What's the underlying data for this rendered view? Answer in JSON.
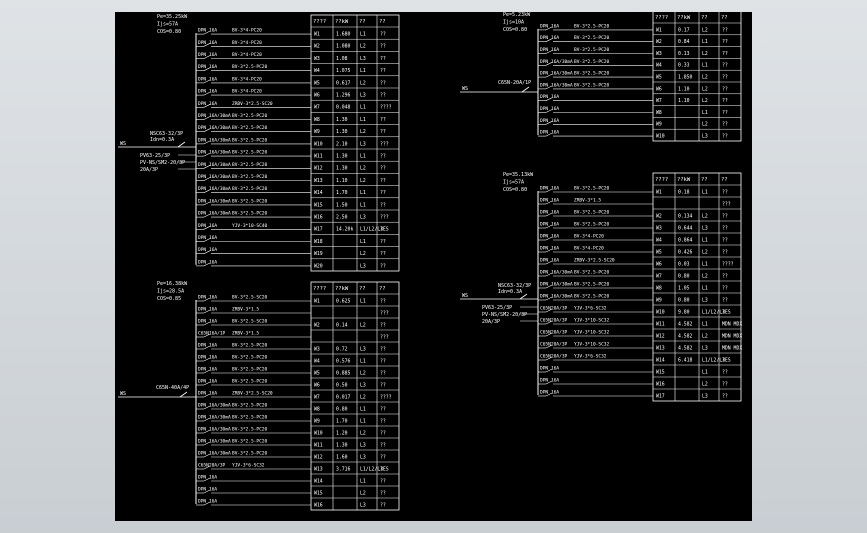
{
  "diagram": {
    "panels": [
      {
        "id": "p1",
        "header": [
          "Pe=35.25kW",
          "Ijs=57A",
          "COS=0.80"
        ],
        "incoming": {
          "label": "WS",
          "breaker": [
            "NSC63-32/3P",
            "Idn=0.3A"
          ],
          "extra": [
            "PV63-25/3P",
            "PV-NS/SM2-20/3P",
            "20A/3P"
          ]
        },
        "header_row": [
          "????",
          "??kW",
          "??",
          "??"
        ],
        "rows": [
          {
            "pre": "DPN",
            "brk": "16A",
            "cable": "BV-3*4-PC20",
            "circ": "W1",
            "kw": "1.680",
            "ph": "L1",
            "use": "??"
          },
          {
            "pre": "DPN",
            "brk": "16A",
            "cable": "BV-3*4-PC20",
            "circ": "W2",
            "kw": "1.080",
            "ph": "L2",
            "use": "??"
          },
          {
            "pre": "DPN",
            "brk": "16A",
            "cable": "BV-3*4-PC20",
            "circ": "W3",
            "kw": "1.08",
            "ph": "L3",
            "use": "??"
          },
          {
            "pre": "DPN",
            "brk": "16A",
            "cable": "BV-3*2.5-PC20",
            "circ": "W4",
            "kw": "1.075",
            "ph": "L1",
            "use": "??"
          },
          {
            "pre": "DPN",
            "brk": "16A",
            "cable": "BV-3*4-PC20",
            "circ": "W5",
            "kw": "0.617",
            "ph": "L2",
            "use": "??"
          },
          {
            "pre": "DPN",
            "brk": "16A",
            "cable": "BV-3*4-PC20",
            "circ": "W6",
            "kw": "1.296",
            "ph": "L3",
            "use": "??"
          },
          {
            "pre": "DPN",
            "brk": "16A",
            "cable": "ZRBV-3*2.5-SC20",
            "circ": "W7",
            "kw": "0.048",
            "ph": "L1",
            "use": "????"
          },
          {
            "pre": "DPN",
            "brk": "16A/30mA",
            "cable": "BV-3*2.5-PC20",
            "circ": "W8",
            "kw": "1.30",
            "ph": "L1",
            "use": "??"
          },
          {
            "pre": "DPN",
            "brk": "16A/30mA",
            "cable": "BV-3*2.5-PC20",
            "circ": "W9",
            "kw": "1.30",
            "ph": "L2",
            "use": "??"
          },
          {
            "pre": "DPN",
            "brk": "16A/30mA",
            "cable": "BV-3*2.5-PC20",
            "circ": "W10",
            "kw": "2.10",
            "ph": "L3",
            "use": "???"
          },
          {
            "pre": "DPN",
            "brk": "16A/30mA",
            "cable": "BV-3*2.5-PC20",
            "circ": "W11",
            "kw": "1.30",
            "ph": "L1",
            "use": "??"
          },
          {
            "pre": "DPN",
            "brk": "16A/30mA",
            "cable": "BV-3*2.5-PC20",
            "circ": "W12",
            "kw": "1.30",
            "ph": "L2",
            "use": "??"
          },
          {
            "pre": "DPN",
            "brk": "16A/30mA",
            "cable": "BV-3*2.5-PC20",
            "circ": "W13",
            "kw": "1.10",
            "ph": "L2",
            "use": "??"
          },
          {
            "pre": "DPN",
            "brk": "16A/30mA",
            "cable": "BV-3*2.5-PC20",
            "circ": "W14",
            "kw": "1.70",
            "ph": "L1",
            "use": "??"
          },
          {
            "pre": "DPN",
            "brk": "16A/30mA",
            "cable": "BV-3*2.5-PC20",
            "circ": "W15",
            "kw": "1.50",
            "ph": "L1",
            "use": "??"
          },
          {
            "pre": "DPN",
            "brk": "16A/30mA",
            "cable": "BV-3*2.5-PC20",
            "circ": "W16",
            "kw": "2.50",
            "ph": "L3",
            "use": "???"
          },
          {
            "pre": "DPN",
            "brk": "16A",
            "cable": "YJV-3*10-SC40",
            "circ": "W17",
            "kw": "14.20k",
            "ph": "L1/L2/L3",
            "use": "IES"
          },
          {
            "pre": "DPN",
            "brk": "16A",
            "cable": "",
            "circ": "W18",
            "kw": "",
            "ph": "L1",
            "use": "??"
          },
          {
            "pre": "DPN",
            "brk": "16A",
            "cable": "",
            "circ": "W19",
            "kw": "",
            "ph": "L2",
            "use": "??"
          },
          {
            "pre": "DPN",
            "brk": "16A",
            "cable": "",
            "circ": "W20",
            "kw": "",
            "ph": "L3",
            "use": "??"
          }
        ]
      },
      {
        "id": "p2",
        "header": [
          "Pe=16.38kW",
          "Ijs=28.5A",
          "COS=0.85"
        ],
        "incoming": {
          "label": "WS",
          "breaker": [
            "C65N-40A/4P"
          ],
          "extra": []
        },
        "header_row": [
          "????",
          "??kW",
          "??",
          "??"
        ],
        "rows": [
          {
            "pre": "DPN",
            "brk": "16A",
            "cable": "BV-3*2.5-SC20",
            "circ": "W1",
            "kw": "0.625",
            "ph": "L1",
            "use": "??"
          },
          {
            "pre": "DPN",
            "brk": "16A",
            "cable": "ZRBV-3*1.5",
            "circ": "",
            "kw": "",
            "ph": "",
            "use": "???"
          },
          {
            "pre": "DPN",
            "brk": "16A",
            "cable": "BV-3*2.5-SC20",
            "circ": "W2",
            "kw": "0.14",
            "ph": "L2",
            "use": "??"
          },
          {
            "pre": "C65N",
            "brk": "16A/1P",
            "cable": "ZRBV-3*1.5",
            "circ": "",
            "kw": "",
            "ph": "",
            "use": "???"
          },
          {
            "pre": "DPN",
            "brk": "16A",
            "cable": "BV-3*2.5-PC20",
            "circ": "W3",
            "kw": "0.72",
            "ph": "L3",
            "use": "??"
          },
          {
            "pre": "DPN",
            "brk": "16A",
            "cable": "BV-3*2.5-PC20",
            "circ": "W4",
            "kw": "0.576",
            "ph": "L1",
            "use": "??"
          },
          {
            "pre": "DPN",
            "brk": "16A",
            "cable": "BV-3*2.5-PC20",
            "circ": "W5",
            "kw": "0.885",
            "ph": "L2",
            "use": "??"
          },
          {
            "pre": "DPN",
            "brk": "16A",
            "cable": "BV-3*2.5-PC20",
            "circ": "W6",
            "kw": "0.50",
            "ph": "L3",
            "use": "??"
          },
          {
            "pre": "DPN",
            "brk": "16A",
            "cable": "ZRBV-3*2.5-SC20",
            "circ": "W7",
            "kw": "0.017",
            "ph": "L2",
            "use": "????"
          },
          {
            "pre": "DPN",
            "brk": "16A/30mA",
            "cable": "BV-3*2.5-PC20",
            "circ": "W8",
            "kw": "0.80",
            "ph": "L1",
            "use": "??"
          },
          {
            "pre": "DPN",
            "brk": "16A/30mA",
            "cable": "BV-3*2.5-PC20",
            "circ": "W9",
            "kw": "1.70",
            "ph": "L1",
            "use": "??"
          },
          {
            "pre": "DPN",
            "brk": "16A/30mA",
            "cable": "BV-3*2.5-PC20",
            "circ": "W10",
            "kw": "1.20",
            "ph": "L2",
            "use": "??"
          },
          {
            "pre": "DPN",
            "brk": "16A/30mA",
            "cable": "BV-3*2.5-PC20",
            "circ": "W11",
            "kw": "1.30",
            "ph": "L3",
            "use": "??"
          },
          {
            "pre": "DPN",
            "brk": "16A/30mA",
            "cable": "BV-3*2.5-PC20",
            "circ": "W12",
            "kw": "1.60",
            "ph": "L3",
            "use": "??"
          },
          {
            "pre": "C65N",
            "brk": "20A/3P",
            "cable": "YJV-3*6-SC32",
            "circ": "W13",
            "kw": "3.716",
            "ph": "L1/L2/L3",
            "use": "IES"
          },
          {
            "pre": "DPN",
            "brk": "16A",
            "cable": "",
            "circ": "W14",
            "kw": "",
            "ph": "L1",
            "use": "??"
          },
          {
            "pre": "DPN",
            "brk": "16A",
            "cable": "",
            "circ": "W15",
            "kw": "",
            "ph": "L2",
            "use": "??"
          },
          {
            "pre": "DPN",
            "brk": "16A",
            "cable": "",
            "circ": "W16",
            "kw": "",
            "ph": "L3",
            "use": "??"
          }
        ]
      },
      {
        "id": "p3",
        "header": [
          "Pe=5.23kW",
          "Ijs=10A",
          "COS=0.80"
        ],
        "incoming": {
          "label": "WS",
          "breaker": [
            "C65N-20A/1P"
          ],
          "extra": []
        },
        "header_row": [
          "????",
          "??kW",
          "??",
          "??"
        ],
        "rows": [
          {
            "pre": "DPN",
            "brk": "16A",
            "cable": "BV-3*2.5-PC20",
            "circ": "W1",
            "kw": "0.17",
            "ph": "L2",
            "use": "??"
          },
          {
            "pre": "DPN",
            "brk": "16A",
            "cable": "BV-3*2.5-PC20",
            "circ": "W2",
            "kw": "0.84",
            "ph": "L1",
            "use": "??"
          },
          {
            "pre": "DPN",
            "brk": "16A",
            "cable": "BV-3*2.5-PC20",
            "circ": "W3",
            "kw": "0.13",
            "ph": "L2",
            "use": "??"
          },
          {
            "pre": "DPN",
            "brk": "16A/30mA",
            "cable": "BV-3*2.5-PC20",
            "circ": "W4",
            "kw": "0.33",
            "ph": "L1",
            "use": "??"
          },
          {
            "pre": "DPN",
            "brk": "16A/30mA",
            "cable": "BV-3*2.5-PC20",
            "circ": "W5",
            "kw": "1.850",
            "ph": "L2",
            "use": "??"
          },
          {
            "pre": "DPN",
            "brk": "16A/30mA",
            "cable": "BV-3*2.5-PC20",
            "circ": "W6",
            "kw": "1.10",
            "ph": "L2",
            "use": "??"
          },
          {
            "pre": "DPN",
            "brk": "16A",
            "cable": "",
            "circ": "W7",
            "kw": "1.10",
            "ph": "L2",
            "use": "??"
          },
          {
            "pre": "DPN",
            "brk": "16A",
            "cable": "",
            "circ": "W8",
            "kw": "",
            "ph": "L1",
            "use": "??"
          },
          {
            "pre": "DPN",
            "brk": "16A",
            "cable": "",
            "circ": "W9",
            "kw": "",
            "ph": "L2",
            "use": "??"
          },
          {
            "pre": "DPN",
            "brk": "16A",
            "cable": "",
            "circ": "W10",
            "kw": "",
            "ph": "L3",
            "use": "??"
          }
        ]
      },
      {
        "id": "p4",
        "header": [
          "Pe=35.13kW",
          "Ijs=57A",
          "COS=0.80"
        ],
        "incoming": {
          "label": "WS",
          "breaker": [
            "NSC63-32/3P",
            "Idn=0.3A"
          ],
          "extra": [
            "PV63-25/3P",
            "PV-NS/SM2-20/3P",
            "20A/3P"
          ]
        },
        "header_row": [
          "????",
          "??kW",
          "??",
          "??"
        ],
        "rows": [
          {
            "pre": "DPN",
            "brk": "16A",
            "cable": "BV-3*2.5-PC20",
            "circ": "W1",
            "kw": "0.18",
            "ph": "L1",
            "use": "??"
          },
          {
            "pre": "DPN",
            "brk": "16A",
            "cable": "ZRBV-3*1.5",
            "circ": "",
            "kw": "",
            "ph": "",
            "use": "???"
          },
          {
            "pre": "DPN",
            "brk": "16A",
            "cable": "BV-3*2.5-PC20",
            "circ": "W2",
            "kw": "0.134",
            "ph": "L2",
            "use": "??"
          },
          {
            "pre": "DPN",
            "brk": "16A",
            "cable": "BV-3*2.5-PC20",
            "circ": "W3",
            "kw": "0.644",
            "ph": "L3",
            "use": "??"
          },
          {
            "pre": "DPN",
            "brk": "16A",
            "cable": "BV-3*4-PC20",
            "circ": "W4",
            "kw": "0.864",
            "ph": "L1",
            "use": "??"
          },
          {
            "pre": "DPN",
            "brk": "16A",
            "cable": "BV-3*4-PC20",
            "circ": "W5",
            "kw": "0.426",
            "ph": "L2",
            "use": "??"
          },
          {
            "pre": "DPN",
            "brk": "16A",
            "cable": "ZRBV-3*2.5-SC20",
            "circ": "W6",
            "kw": "0.03",
            "ph": "L1",
            "use": "????"
          },
          {
            "pre": "DPN",
            "brk": "16A/30mA",
            "cable": "BV-3*2.5-PC20",
            "circ": "W7",
            "kw": "0.80",
            "ph": "L2",
            "use": "??"
          },
          {
            "pre": "DPN",
            "brk": "16A/30mA",
            "cable": "BV-3*2.5-PC20",
            "circ": "W8",
            "kw": "1.05",
            "ph": "L1",
            "use": "??"
          },
          {
            "pre": "DPN",
            "brk": "16A/30mA",
            "cable": "BV-3*2.5-PC20",
            "circ": "W9",
            "kw": "0.80",
            "ph": "L3",
            "use": "??"
          },
          {
            "pre": "C65N",
            "brk": "20A/3P",
            "cable": "YJV-3*6-SC32",
            "circ": "W10",
            "kw": "9.80",
            "ph": "L1/L2/L3",
            "use": "IES"
          },
          {
            "pre": "C65N",
            "brk": "20A/3P",
            "cable": "YJV-3*10-SC32",
            "circ": "W11",
            "kw": "4.582",
            "ph": "L1",
            "use": "MDN MDX"
          },
          {
            "pre": "C65N",
            "brk": "20A/3P",
            "cable": "YJV-3*10-SC32",
            "circ": "W12",
            "kw": "4.582",
            "ph": "L2",
            "use": "MDN MDX"
          },
          {
            "pre": "C65N",
            "brk": "20A/3P",
            "cable": "YJV-3*10-SC32",
            "circ": "W13",
            "kw": "4.582",
            "ph": "L3",
            "use": "MDN MDX"
          },
          {
            "pre": "C65N",
            "brk": "20A/3P",
            "cable": "YJV-3*6-SC32",
            "circ": "W14",
            "kw": "6.418",
            "ph": "L1/L2/L3",
            "use": "IES"
          },
          {
            "pre": "DPN",
            "brk": "16A",
            "cable": "",
            "circ": "W15",
            "kw": "",
            "ph": "L1",
            "use": "??"
          },
          {
            "pre": "DPN",
            "brk": "16A",
            "cable": "",
            "circ": "W16",
            "kw": "",
            "ph": "L2",
            "use": "??"
          },
          {
            "pre": "DPN",
            "brk": "16A",
            "cable": "",
            "circ": "W17",
            "kw": "",
            "ph": "L3",
            "use": "??"
          }
        ]
      }
    ],
    "colors": {
      "background": "#000000",
      "line": "#ffffff",
      "frame": "#d4d8dc"
    }
  }
}
